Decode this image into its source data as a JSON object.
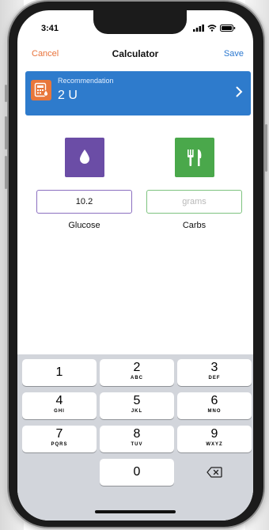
{
  "status": {
    "time": "3:41"
  },
  "nav": {
    "cancel": "Cancel",
    "title": "Calculator",
    "save": "Save"
  },
  "recommendation": {
    "label": "Recommendation",
    "value": "2 U"
  },
  "glucose": {
    "value": "10.2",
    "label": "Glucose",
    "icon": "drop-icon",
    "color": "#6b4da6"
  },
  "carbs": {
    "value": "",
    "placeholder": "grams",
    "label": "Carbs",
    "icon": "fork-knife-icon",
    "color": "#4aa84b"
  },
  "keypad": {
    "keys": [
      {
        "digit": "1",
        "letters": ""
      },
      {
        "digit": "2",
        "letters": "ABC"
      },
      {
        "digit": "3",
        "letters": "DEF"
      },
      {
        "digit": "4",
        "letters": "GHI"
      },
      {
        "digit": "5",
        "letters": "JKL"
      },
      {
        "digit": "6",
        "letters": "MNO"
      },
      {
        "digit": "7",
        "letters": "PQRS"
      },
      {
        "digit": "8",
        "letters": "TUV"
      },
      {
        "digit": "9",
        "letters": "WXYZ"
      },
      {
        "digit": "0",
        "letters": ""
      }
    ]
  },
  "colors": {
    "accent_orange": "#e8733b",
    "accent_blue": "#2b78d0",
    "banner_blue": "#2e7bcc"
  }
}
